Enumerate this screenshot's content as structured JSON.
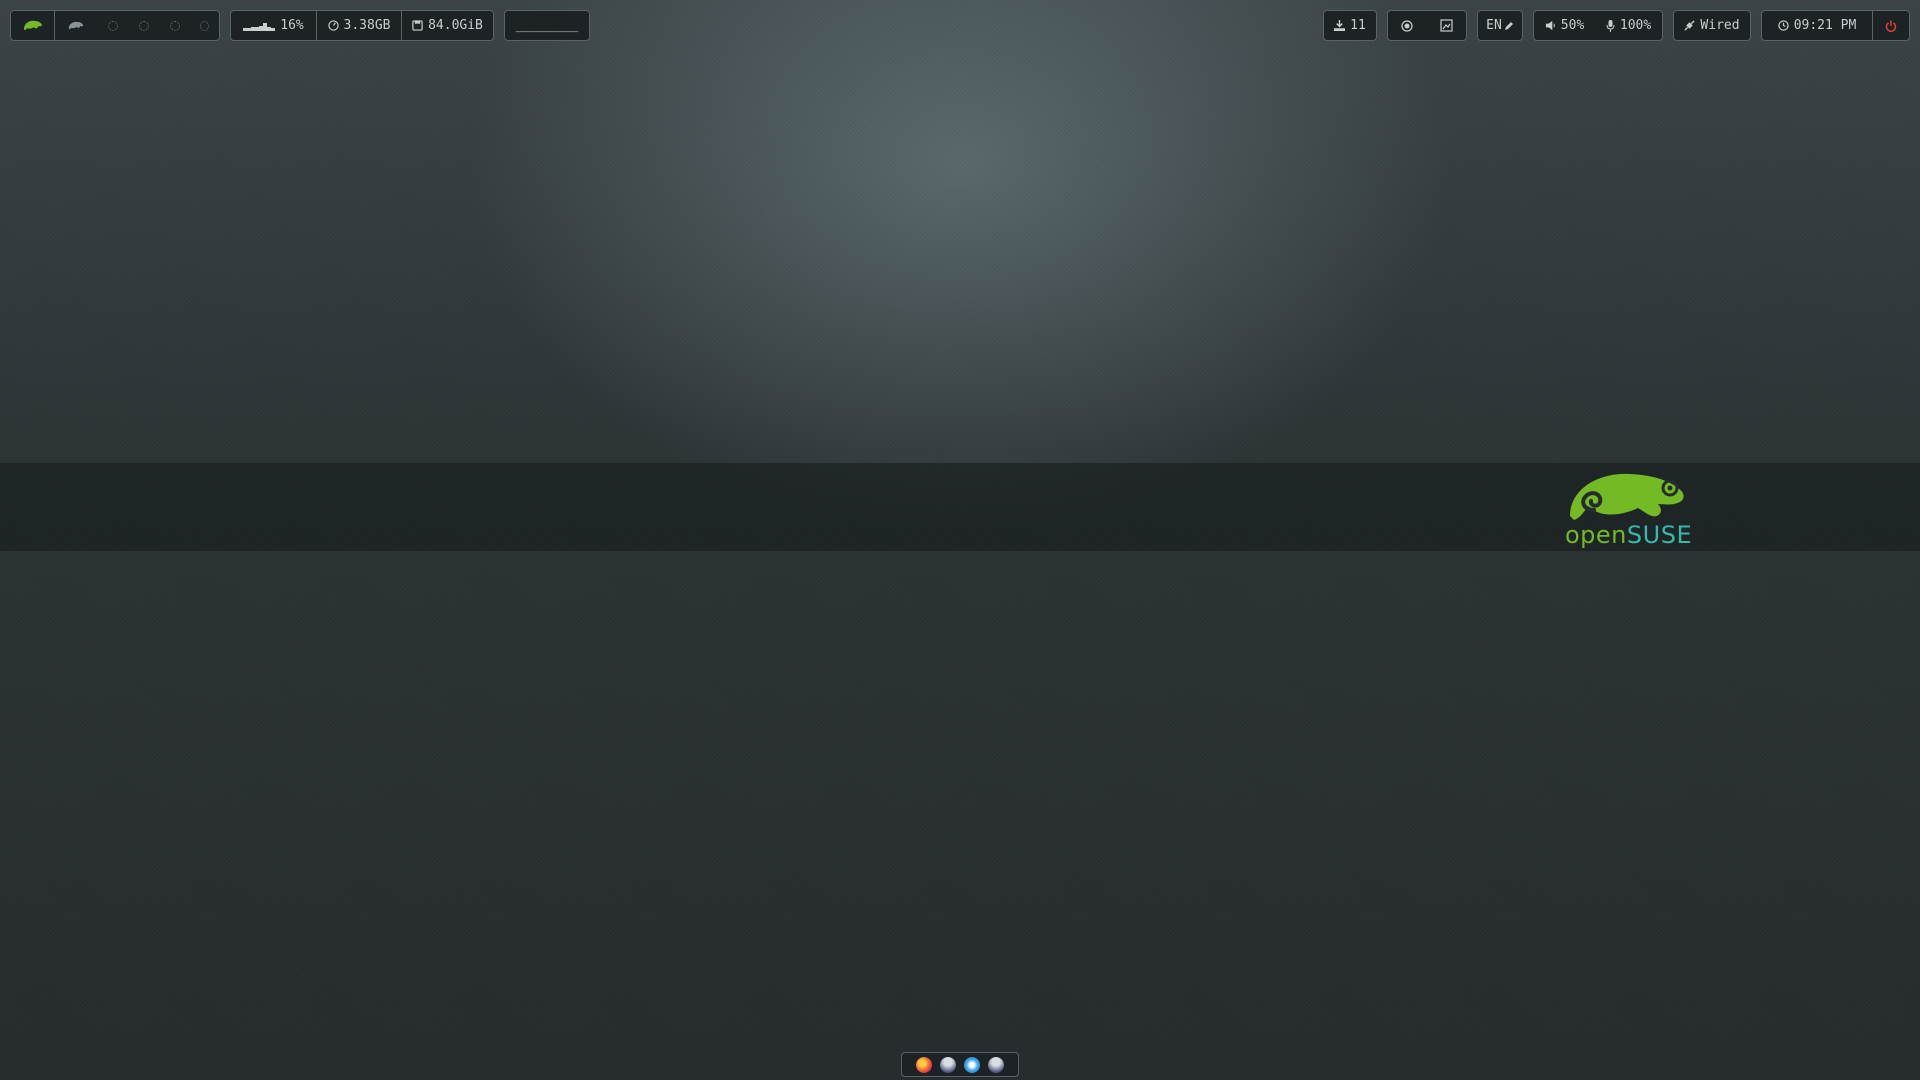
{
  "desktop": {
    "logo": {
      "text_open": "open",
      "text_suse": "SUSE"
    }
  },
  "topbar": {
    "workspaces": {
      "active_icon": "opensuse-chameleon-icon",
      "items": [
        "chameleon-icon",
        "gear-icon",
        "gear-icon",
        "gear-icon",
        "gear-icon"
      ]
    },
    "system": {
      "cpu_percent": "16%",
      "memory": "3.38GB",
      "disk": "84.0GiB"
    },
    "media": {
      "placeholder": "________"
    },
    "updates": {
      "count": "11"
    },
    "tools": [
      "record-icon",
      "screenshot-icon"
    ],
    "keyboard": {
      "layout": "EN"
    },
    "audio": {
      "volume": "50%",
      "mic": "100%"
    },
    "network": {
      "label": "Wired"
    },
    "clock": {
      "time": "09:21 PM"
    },
    "power": {
      "icon": "power-icon"
    },
    "colors": {
      "accent_green": "#73ba25",
      "teal": "#35b9ab",
      "power_red": "#e0403a",
      "bar_bg": "#1d2224",
      "border": "#5a6366"
    }
  },
  "dock": {
    "apps": [
      "firefox-icon",
      "app-icon",
      "vscode-icon",
      "app-icon"
    ]
  }
}
